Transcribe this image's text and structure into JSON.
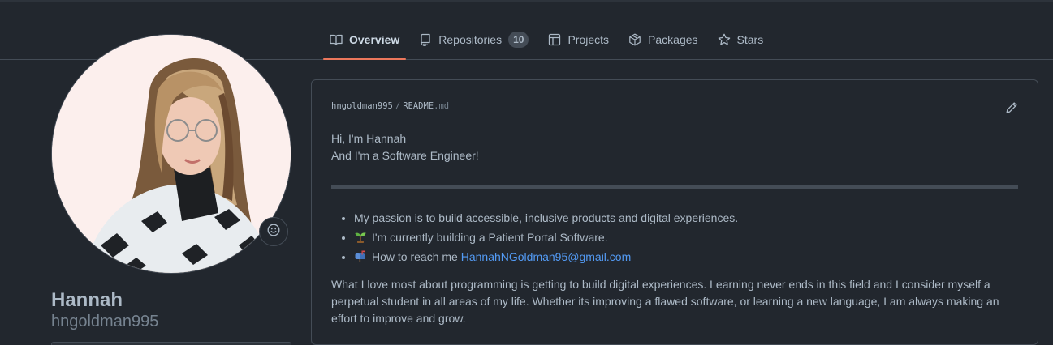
{
  "nav": {
    "tabs": [
      {
        "label": "Overview",
        "icon": "book-icon",
        "active": true
      },
      {
        "label": "Repositories",
        "icon": "repo-icon",
        "count": "10"
      },
      {
        "label": "Projects",
        "icon": "table-icon"
      },
      {
        "label": "Packages",
        "icon": "package-icon"
      },
      {
        "label": "Stars",
        "icon": "star-icon"
      }
    ]
  },
  "profile": {
    "name": "Hannah",
    "login": "hngoldman995",
    "status_icon": "smiley-icon"
  },
  "readme": {
    "owner": "hngoldman995",
    "separator": "/",
    "file_base": "README",
    "file_ext": ".md",
    "greeting": "Hi, I'm Hannah",
    "role": "And I'm a Software Engineer!",
    "bullets": {
      "passion": "My passion is to build accessible, inclusive products and digital experiences.",
      "building": "I'm currently building a Patient Portal Software.",
      "reach_prefix": "How to reach me",
      "email": "HannahNGoldman95@gmail.com"
    },
    "paragraph": "What I love most about programming is getting to build digital experiences. Learning never ends in this field and I consider myself a perpetual student in all areas of my life. Whether its improving a flawed software, or learning a new language, I am always making an effort to improve and grow.",
    "edit_icon": "pencil-icon"
  },
  "colors": {
    "background": "#22272e",
    "border": "#444c56",
    "accent_underline": "#ec775c",
    "link": "#539bf5"
  }
}
